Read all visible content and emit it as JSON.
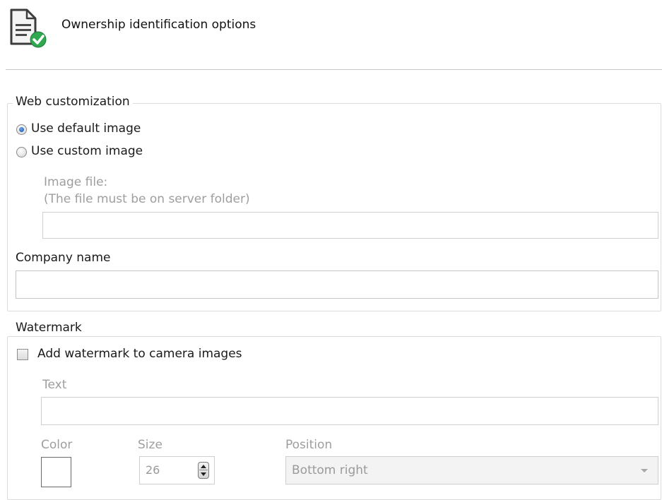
{
  "header": {
    "title": "Ownership identification options",
    "icon": "document-checkmark-icon"
  },
  "web_customization": {
    "legend": "Web customization",
    "option_default": "Use default image",
    "option_custom": "Use custom image",
    "selected": "Use default image",
    "image_file_label": "Image file:",
    "image_file_hint": "(The file must be on server folder)",
    "image_file_value": "",
    "company_name_label": "Company name",
    "company_name_value": ""
  },
  "watermark": {
    "legend": "Watermark",
    "checkbox_label": "Add watermark to camera images",
    "checked": false,
    "text_label": "Text",
    "text_value": "",
    "color_label": "Color",
    "color_value": "#ffffff",
    "size_label": "Size",
    "size_value": "26",
    "position_label": "Position",
    "position_value": "Bottom right"
  }
}
